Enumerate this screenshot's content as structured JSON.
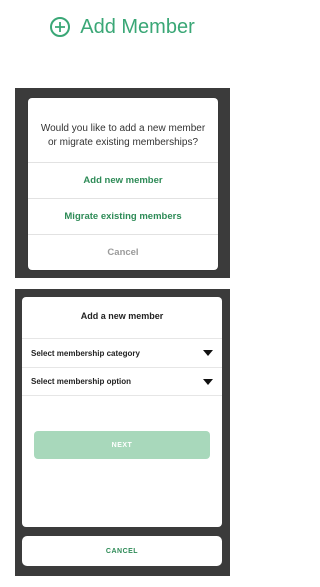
{
  "header": {
    "add_member_label": "Add Member"
  },
  "dialog_choice": {
    "question": "Would you like to add a new member or migrate existing memberships?",
    "add_new_label": "Add new member",
    "migrate_label": "Migrate existing members",
    "cancel_label": "Cancel"
  },
  "dialog_add": {
    "title": "Add a new member",
    "category_select": "Select membership category",
    "option_select": "Select membership option",
    "next_label": "NEXT",
    "cancel_label": "CANCEL"
  },
  "colors": {
    "brand_green": "#3aa776",
    "action_green": "#2e8b57",
    "disabled_green": "#a8d8bb",
    "backdrop": "#3b3b3b"
  }
}
